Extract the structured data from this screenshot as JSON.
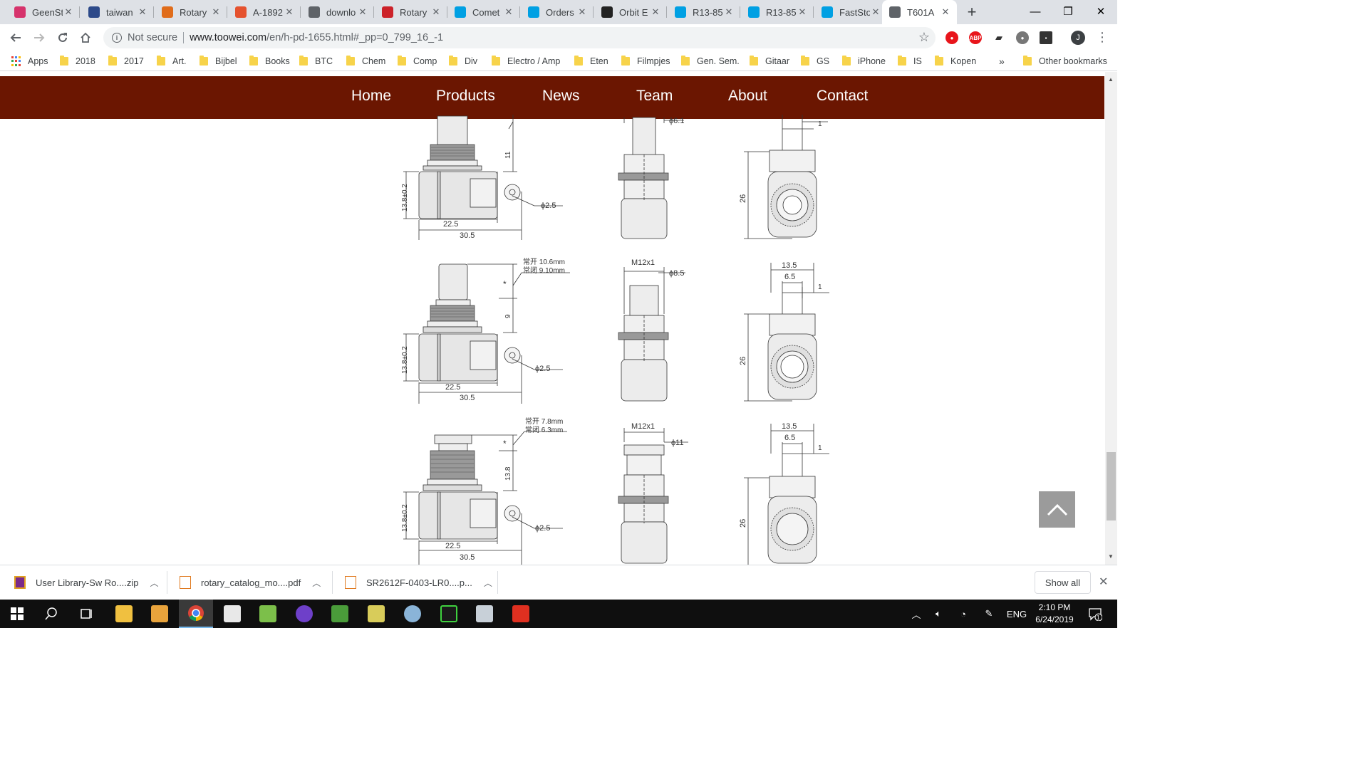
{
  "tabs": [
    {
      "title": "GeenSt",
      "icon": "geenstijl-icon",
      "color": "#d6336c"
    },
    {
      "title": "taiwan",
      "icon": "m-letter-icon",
      "color": "#2d4a8a"
    },
    {
      "title": "Rotary",
      "icon": "person-icon",
      "color": "#e06c1a"
    },
    {
      "title": "A-1892",
      "icon": "magento-icon",
      "color": "#e5522e"
    },
    {
      "title": "downlo",
      "icon": "globe-icon",
      "color": "#5f6368"
    },
    {
      "title": "Rotary",
      "icon": "a-letter-icon",
      "color": "#cc2229"
    },
    {
      "title": "Comet",
      "icon": "ce-icon",
      "color": "#00a0e3"
    },
    {
      "title": "Orders",
      "icon": "ce-icon",
      "color": "#00a0e3"
    },
    {
      "title": "Orbit E",
      "icon": "orbit-icon",
      "color": "#222222"
    },
    {
      "title": "R13-85",
      "icon": "ce-icon",
      "color": "#00a0e3"
    },
    {
      "title": "R13-85",
      "icon": "ce-icon",
      "color": "#00a0e3"
    },
    {
      "title": "FastSto",
      "icon": "ce-icon",
      "color": "#00a0e3"
    },
    {
      "title": "T601A",
      "icon": "globe-icon",
      "color": "#5f6368",
      "active": true
    }
  ],
  "omnibox": {
    "security": "Not secure",
    "url_host": "www.toowei.com",
    "url_path": "/en/h-pd-1655.html#_pp=0_799_16_-1"
  },
  "bookmarks": {
    "apps": "Apps",
    "items": [
      "2018",
      "2017",
      "Art.",
      "Bijbel",
      "Books",
      "BTC",
      "Chem",
      "Comp",
      "Div",
      "Electro / Amp",
      "Eten",
      "Filmpjes",
      "Gen. Sem.",
      "Gitaar",
      "GS",
      "iPhone",
      "IS",
      "Kopen"
    ],
    "overflow": "»",
    "other": "Other bookmarks"
  },
  "site_nav": [
    "Home",
    "Products",
    "News",
    "Team",
    "About",
    "Contact"
  ],
  "drawings": {
    "row1": {
      "phi_cap": "ϕ6.1",
      "dim_11": "11",
      "h138": "13.8±0.2",
      "w225": "22.5",
      "w305": "30.5",
      "phi25": "ϕ2.5",
      "h26": "26",
      "d1": "1"
    },
    "row2": {
      "note1": "常开 10.6mm",
      "note2": "常闭 9.10mm",
      "thread": "M12x1",
      "phi_cap": "ϕ8.5",
      "star": "*",
      "dim": "9",
      "h138": "13.8±0.2",
      "w225": "22.5",
      "w305": "30.5",
      "phi25": "ϕ2.5",
      "w135": "13.5",
      "w65": "6.5",
      "d1": "1",
      "h26": "26"
    },
    "row3": {
      "note1": "常开 7.8mm",
      "note2": "常闭 6.3mm",
      "thread": "M12x1",
      "phi_cap": "ϕ11",
      "star": "*",
      "dim": "13.8",
      "h138": "13.8±0.2",
      "w225": "22.5",
      "w305": "30.5",
      "phi25": "ϕ2.5",
      "w135": "13.5",
      "w65": "6.5",
      "d1": "1",
      "h26": "26"
    }
  },
  "downloads": [
    {
      "name": "User Library-Sw Ro....zip",
      "icon": "zip-archive-icon"
    },
    {
      "name": "rotary_catalog_mo....pdf",
      "icon": "pdf-file-icon"
    },
    {
      "name": "SR2612F-0403-LR0....p...",
      "icon": "pdf-file-icon"
    }
  ],
  "downloads_show_all": "Show all",
  "taskbar": {
    "lang": "ENG",
    "time": "2:10 PM",
    "date": "6/24/2019",
    "notifications": "1"
  },
  "colors": {
    "site_nav_bg": "#6b1601",
    "tabstrip_bg": "#dee1e6",
    "taskbar_bg": "#0f0f0f"
  }
}
